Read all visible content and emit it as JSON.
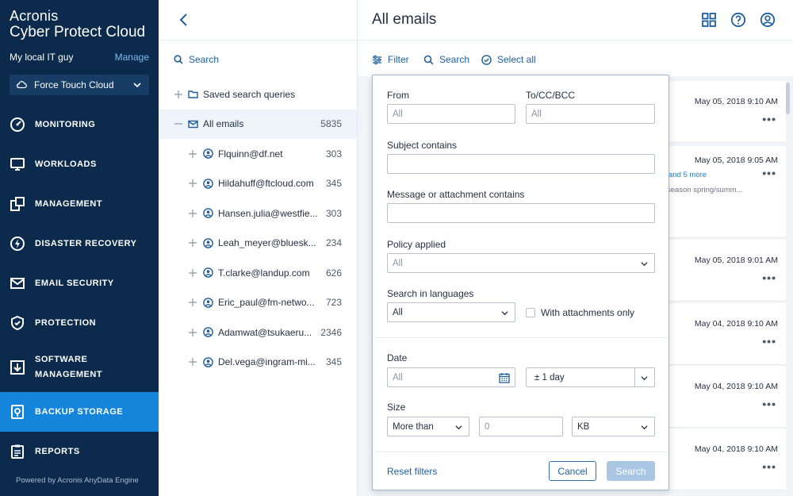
{
  "brand": {
    "line1": "Acronis",
    "line2": "Cyber Protect Cloud"
  },
  "account": {
    "name": "My local IT guy",
    "manage": "Manage"
  },
  "tenant": {
    "name": "Force Touch Cloud",
    "icon": "cloud-icon"
  },
  "nav": {
    "items": [
      {
        "label": "MONITORING",
        "icon": "monitoring-icon"
      },
      {
        "label": "WORKLOADS",
        "icon": "monitor-icon"
      },
      {
        "label": "MANAGEMENT",
        "icon": "management-icon"
      },
      {
        "label": "DISASTER RECOVERY",
        "icon": "disaster-recovery-icon"
      },
      {
        "label": "EMAIL SECURITY",
        "icon": "envelope-icon"
      },
      {
        "label": "PROTECTION",
        "icon": "shield-icon"
      },
      {
        "label_line1": "SOFTWARE",
        "label_line2": "MANAGEMENT",
        "icon": "software-icon"
      },
      {
        "label": "BACKUP STORAGE",
        "icon": "storage-icon",
        "active": true
      },
      {
        "label": "REPORTS",
        "icon": "reports-icon"
      }
    ],
    "active_color": "#1584db"
  },
  "powered_by": "Powered by Acronis AnyData Engine",
  "middle": {
    "search_label": "Search",
    "tree": [
      {
        "label": "Saved search queries",
        "count": "",
        "icon": "folder-icon",
        "level": 0,
        "expander": "plus"
      },
      {
        "label": "All emails",
        "count": "5835",
        "icon": "envelope-icon",
        "level": 0,
        "expander": "minus",
        "selected": true
      },
      {
        "label": "Flquinn@df.net",
        "count": "303",
        "icon": "user-icon",
        "level": 1,
        "expander": "plus"
      },
      {
        "label": "Hildahuff@ftcloud.com",
        "count": "345",
        "icon": "user-icon",
        "level": 1,
        "expander": "plus"
      },
      {
        "label": "Hansen.julia@westfie...",
        "count": "303",
        "icon": "user-icon",
        "level": 1,
        "expander": "plus"
      },
      {
        "label": "Leah_meyer@bluesk...",
        "count": "234",
        "icon": "user-icon",
        "level": 1,
        "expander": "plus"
      },
      {
        "label": "T.clarke@landup.com",
        "count": "626",
        "icon": "user-icon",
        "level": 1,
        "expander": "plus"
      },
      {
        "label": "Eric_paul@fm-netwo...",
        "count": "723",
        "icon": "user-icon",
        "level": 1,
        "expander": "plus"
      },
      {
        "label": "Adamwat@tsukaeru...",
        "count": "2346",
        "icon": "user-icon",
        "level": 1,
        "expander": "plus"
      },
      {
        "label": "Del.vega@ingram-mi...",
        "count": "345",
        "icon": "user-icon",
        "level": 1,
        "expander": "plus"
      }
    ]
  },
  "main": {
    "title": "All emails",
    "toolbar": {
      "filter": "Filter",
      "search": "Search",
      "select_all": "Select all"
    },
    "mails": [
      {
        "date": "May 05, 2018  9:10 AM",
        "more": "",
        "snippet": ""
      },
      {
        "date": "May 05, 2018  9:05 AM",
        "more": "and 5 more",
        "snippet": "season spring/summ..."
      },
      {
        "date": "May 05, 2018  9:01 AM",
        "more": "",
        "snippet": ""
      },
      {
        "date": "May 04, 2018  9:10 AM",
        "more": "",
        "snippet": ""
      },
      {
        "date": "May 04, 2018  9:10 AM",
        "more": "",
        "snippet": ""
      },
      {
        "date": "May 04, 2018  9:10 AM",
        "more": "",
        "snippet": ""
      }
    ],
    "dots": "•••"
  },
  "filter": {
    "from_label": "From",
    "from_value": "All",
    "to_label": "To/CC/BCC",
    "to_value": "All",
    "subject_label": "Subject contains",
    "subject_value": "",
    "message_label": "Message or attachment contains",
    "message_value": "",
    "policy_label": "Policy applied",
    "policy_value": "All",
    "languages_label": "Search in languages",
    "languages_value": "All",
    "attachments_label": "With attachments only",
    "attachments_checked": false,
    "date_label": "Date",
    "date_value": "All",
    "date_range_value": "± 1 day",
    "size_label": "Size",
    "size_comparator": "More than",
    "size_value": "0",
    "size_unit": "KB",
    "reset_label": "Reset filters",
    "cancel_label": "Cancel",
    "search_label": "Search"
  }
}
